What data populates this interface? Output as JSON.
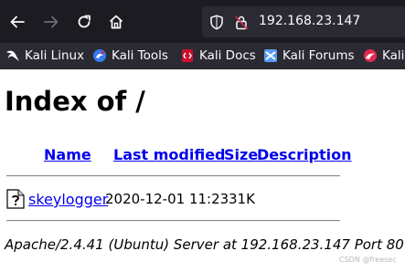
{
  "browser": {
    "url": "192.168.23.147",
    "bookmarks": [
      {
        "label": "Kali Linux",
        "icon": "kali-dragon-icon"
      },
      {
        "label": "Kali Tools",
        "icon": "kali-tools-icon"
      },
      {
        "label": "Kali Docs",
        "icon": "kali-docs-icon"
      },
      {
        "label": "Kali Forums",
        "icon": "kali-forums-icon"
      },
      {
        "label": "Kali",
        "icon": "kali-nethunter-icon"
      }
    ]
  },
  "page": {
    "title": "Index of /",
    "columns": {
      "name": "Name",
      "last_modified": "Last modified",
      "size": "Size",
      "description": "Description"
    },
    "rows": [
      {
        "name": "skeylogger",
        "modified": "2020-12-01 11:23",
        "size": "31K",
        "description": ""
      }
    ],
    "address": "Apache/2.4.41 (Ubuntu) Server at 192.168.23.147 Port 80"
  },
  "watermark": "CSDN @freesec",
  "colors": {
    "toolbar_bg": "#1c1b22",
    "urlbar_bg": "#2b2a33",
    "link": "#0000ee"
  }
}
